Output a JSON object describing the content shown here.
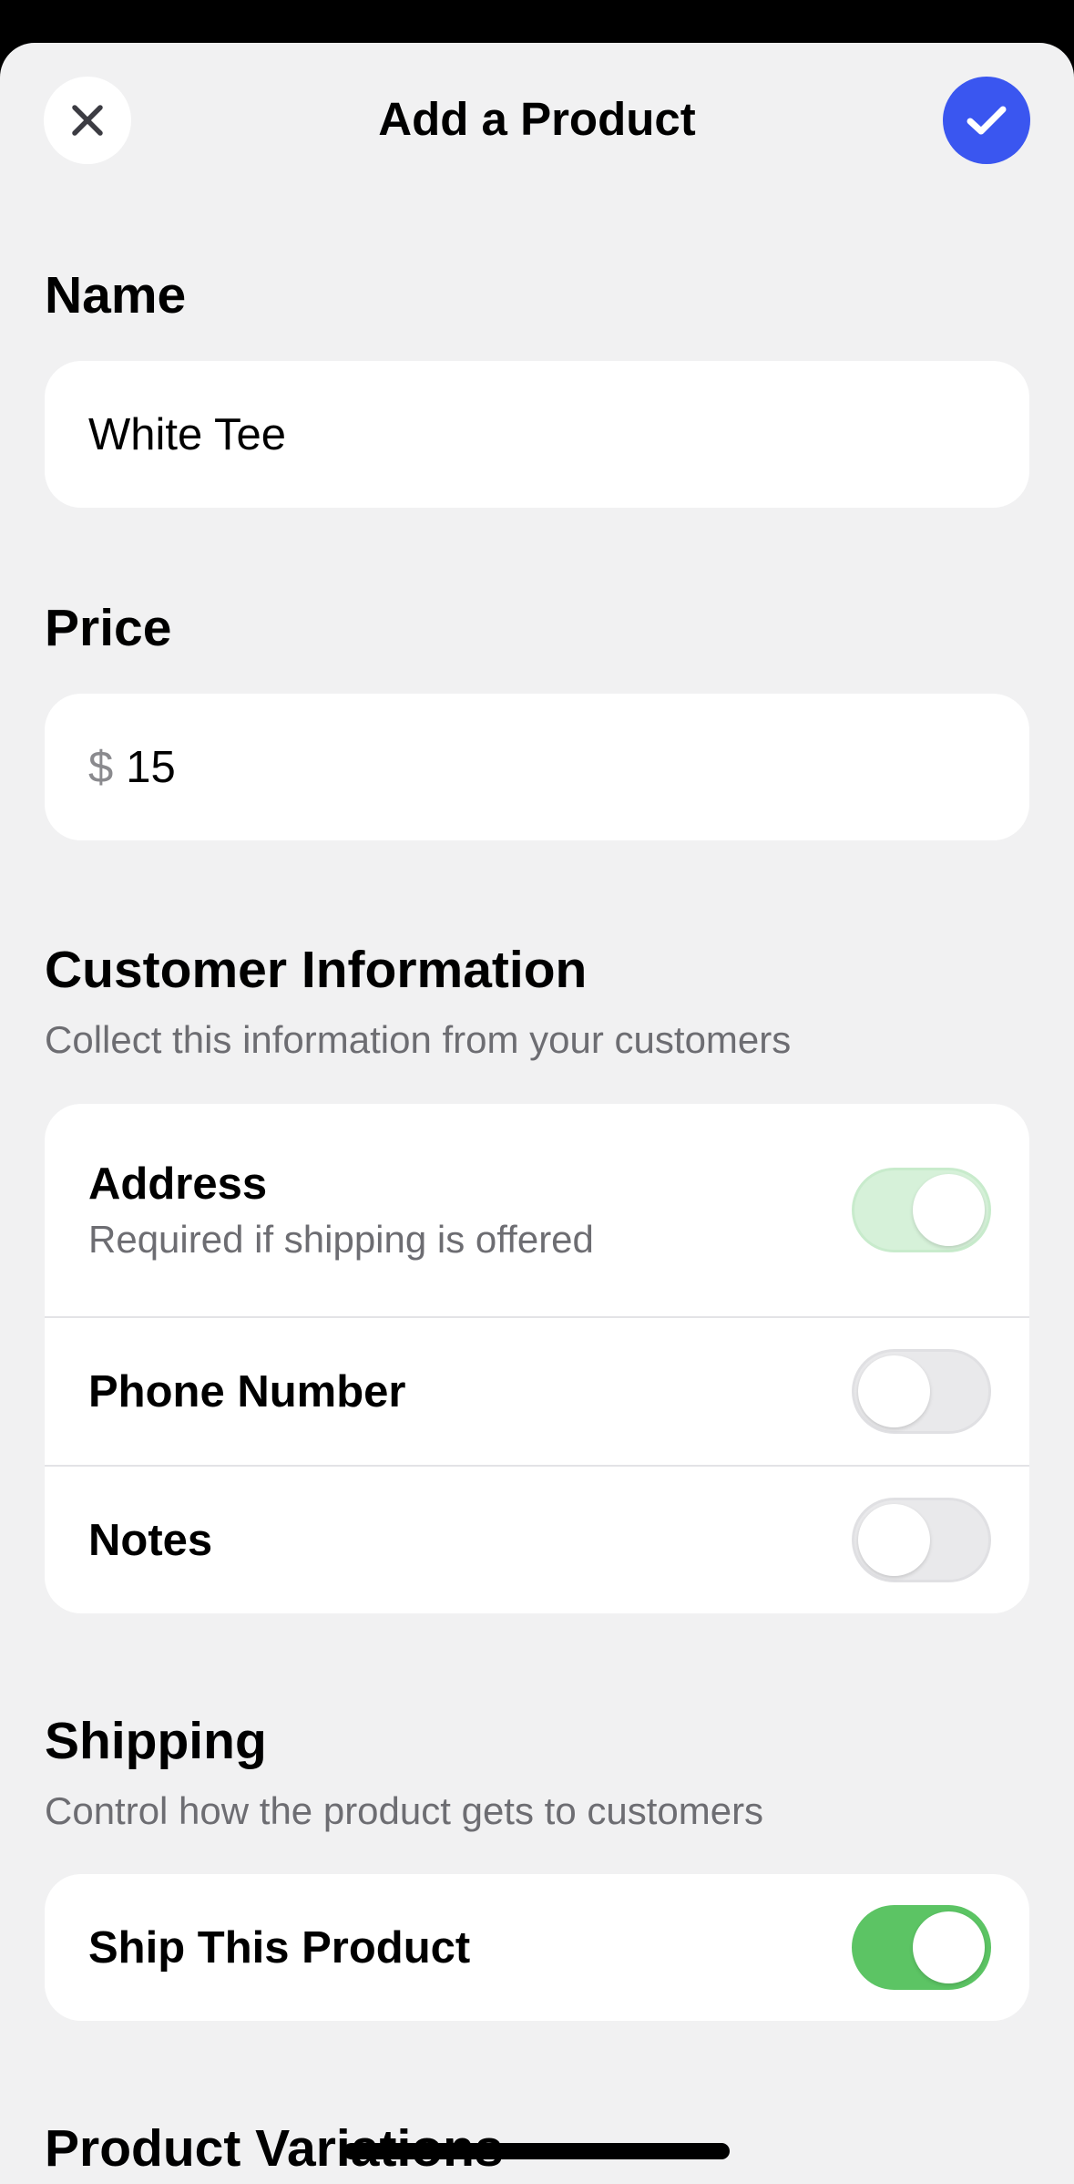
{
  "header": {
    "title": "Add a Product",
    "close_icon": "close-icon",
    "confirm_icon": "checkmark-icon",
    "accent_color": "#3a56f0"
  },
  "name_section": {
    "heading": "Name",
    "value": "White Tee"
  },
  "price_section": {
    "heading": "Price",
    "currency_symbol": "$",
    "value": "15"
  },
  "customer_info": {
    "heading": "Customer Information",
    "subtitle": "Collect this information from your customers",
    "rows": [
      {
        "label": "Address",
        "sublabel": "Required if shipping is offered",
        "enabled": true
      },
      {
        "label": "Phone Number",
        "enabled": false
      },
      {
        "label": "Notes",
        "enabled": false
      }
    ]
  },
  "shipping": {
    "heading": "Shipping",
    "subtitle": "Control how the product gets to customers",
    "rows": [
      {
        "label": "Ship This Product",
        "enabled": true
      }
    ]
  },
  "product_variations": {
    "heading": "Product Variations"
  },
  "colors": {
    "toggle_on": "#5cc464",
    "toggle_on_disabled": "#d6f1d9",
    "toggle_off": "#e9e9eb"
  }
}
